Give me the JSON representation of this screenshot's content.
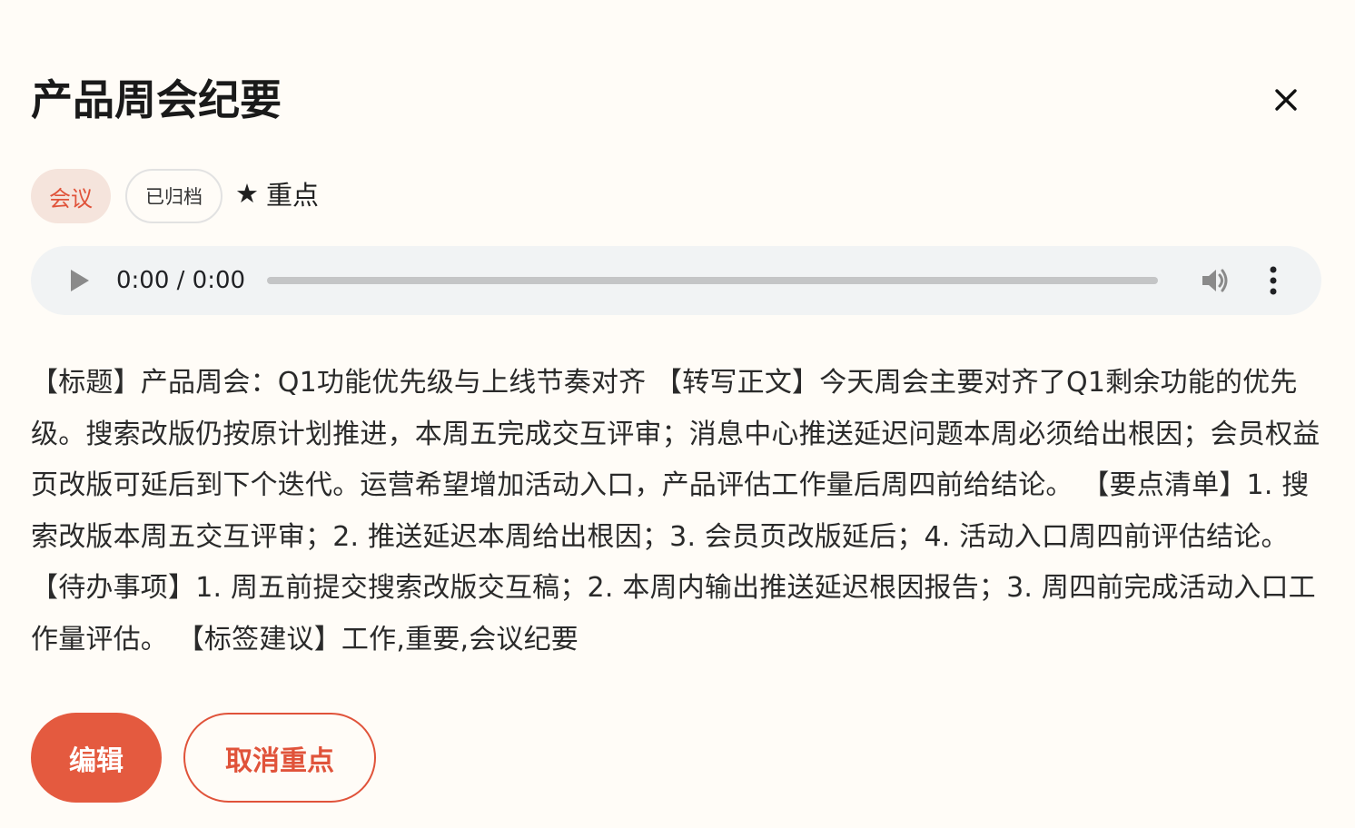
{
  "dialog": {
    "title": "产品周会纪要",
    "close_icon": "close-icon"
  },
  "tags": {
    "category": "会议",
    "status": "已归档",
    "star_symbol": "★",
    "star_label": "重点"
  },
  "audio": {
    "time": "0:00 / 0:00",
    "progress": 0,
    "icons": [
      "play-icon",
      "volume-icon",
      "more-vertical-icon"
    ]
  },
  "content": {
    "text": "【标题】产品周会：Q1功能优先级与上线节奏对齐 【转写正文】今天周会主要对齐了Q1剩余功能的优先级。搜索改版仍按原计划推进，本周五完成交互评审；消息中心推送延迟问题本周必须给出根因；会员权益页改版可延后到下个迭代。运营希望增加活动入口，产品评估工作量后周四前给结论。 【要点清单】1. 搜索改版本周五交互评审；2. 推送延迟本周给出根因；3. 会员页改版延后；4. 活动入口周四前评估结论。 【待办事项】1. 周五前提交搜索改版交互稿；2. 本周内输出推送延迟根因报告；3. 周四前完成活动入口工作量评估。 【标签建议】工作,重要,会议纪要"
  },
  "actions": {
    "edit_label": "编辑",
    "unstar_label": "取消重点"
  },
  "colors": {
    "accent": "#e45a3f",
    "background": "#fffcf7",
    "tag_bg": "#f5e4dc",
    "player_bg": "#f1f3f4"
  }
}
